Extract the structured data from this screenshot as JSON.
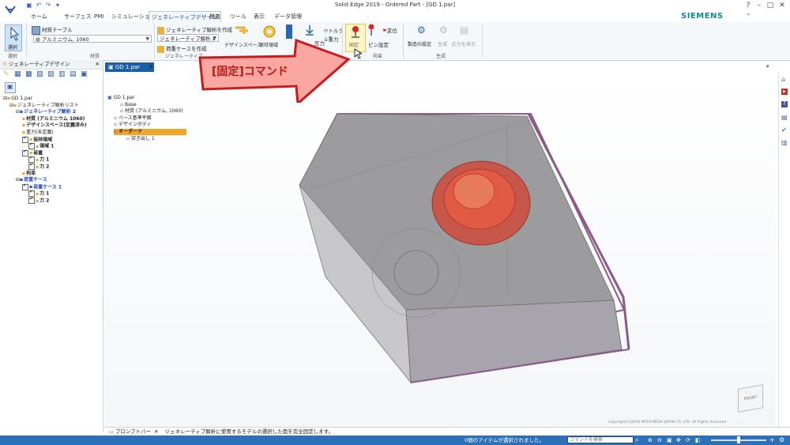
{
  "window": {
    "title": "Solid Edge 2019 - Ordered Part - [GD 1.par]",
    "brand": "SIEMENS",
    "brand_color": "#0f8a91"
  },
  "menu_tabs": [
    "ホーム",
    "サーフェス",
    "PMI",
    "シミュレーション",
    "ジェネレーティブデザイン",
    "検査",
    "ツール",
    "表示",
    "データ管理"
  ],
  "active_tab": "ジェネレーティブデザイン",
  "ribbon": {
    "select": {
      "label": "選択",
      "group": "選択"
    },
    "material": {
      "table_label": "材質テーブル",
      "material_value": "アルミニウム, 1060",
      "group": "材質"
    },
    "study": {
      "create_label": "ジェネレーティブ解析を作成",
      "study_value": "ジェネレーティブ解析 2",
      "load_case_label": "荷重ケースを作成",
      "group": "ジェネレーティブ"
    },
    "design_space": {
      "label": "デザインスペース",
      "preserve_label": "保持領域"
    },
    "loads": {
      "torque": "トルク",
      "pressure": "圧力",
      "gravity": "重力"
    },
    "constraints": {
      "fixed": "固定",
      "pin": "ピン設定",
      "displacement": "変位",
      "group": "拘束"
    },
    "generate": {
      "manufacturing": "製造の設定",
      "generate": "生成",
      "show_stress": "応力を表示",
      "group": "生成"
    }
  },
  "left_panel": {
    "title": "ジェネレーティブデザイン",
    "tree": [
      {
        "text": "GD 1.par",
        "indent": 0,
        "check": null,
        "style": "normal"
      },
      {
        "text": "ジェネレーティブ解析リスト",
        "indent": 1,
        "check": null,
        "style": "normal"
      },
      {
        "text": "ジェネレーティブ解析 2",
        "indent": 2,
        "check": null,
        "style": "blue"
      },
      {
        "text": "材質 (アルミニウム 1060)",
        "indent": 3,
        "check": null,
        "style": "bold"
      },
      {
        "text": "デザインスペース(定義済み)",
        "indent": 3,
        "check": null,
        "style": "bold"
      },
      {
        "text": "重力(未定義)",
        "indent": 3,
        "check": null,
        "style": "normal"
      },
      {
        "text": "保持領域",
        "indent": 3,
        "check": true,
        "style": "bold"
      },
      {
        "text": "領域 1",
        "indent": 4,
        "check": true,
        "style": "bold"
      },
      {
        "text": "荷重",
        "indent": 3,
        "check": true,
        "style": "bold"
      },
      {
        "text": "力 1",
        "indent": 4,
        "check": true,
        "style": "bold"
      },
      {
        "text": "力 2",
        "indent": 4,
        "check": true,
        "style": "bold"
      },
      {
        "text": "拘束",
        "indent": 3,
        "check": null,
        "style": "bold"
      },
      {
        "text": "荷重ケース",
        "indent": 2,
        "check": null,
        "style": "blue"
      },
      {
        "text": "荷重ケース 1",
        "indent": 3,
        "check": true,
        "style": "blue"
      },
      {
        "text": "力 1",
        "indent": 4,
        "check": true,
        "style": "bold"
      },
      {
        "text": "力 2",
        "indent": 4,
        "check": true,
        "style": "bold"
      }
    ]
  },
  "document_tab": "GD 1.par",
  "viewport_tree": [
    {
      "text": "GD 1.par",
      "style": "normal"
    },
    {
      "text": "Base",
      "style": "normal"
    },
    {
      "text": "材質 (アルミニウム, 1060)",
      "style": "normal"
    },
    {
      "text": "ベース基準平面",
      "style": "normal"
    },
    {
      "text": "デザインボディ",
      "style": "normal"
    },
    {
      "text": "オーダード",
      "style": "highlight"
    },
    {
      "text": "突き出し 1",
      "style": "normal"
    }
  ],
  "callout": {
    "text": "[固定]コマンド"
  },
  "prompt": {
    "label": "プロンプトバー",
    "message": "ジェネレーティブ解析に使用するモデルの選択した面を完全固定します。",
    "copyright": "Copyright(C)2018 INTER-MESH JAPAN CO.,LTD.  All Rights Reserved"
  },
  "status": {
    "selection": "0個のアイテムが選択されました。",
    "command_search_placeholder": "コマンドを検索"
  },
  "view_cube_label": "FRONT"
}
